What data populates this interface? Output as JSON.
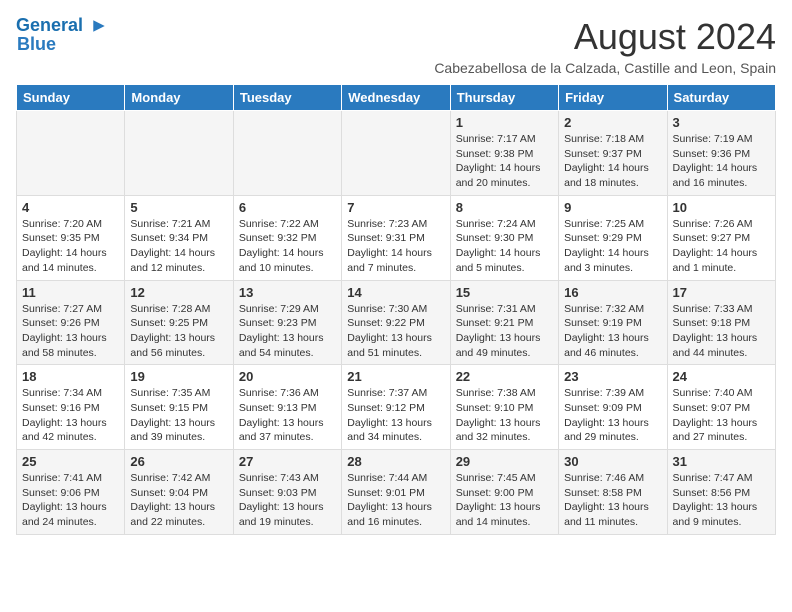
{
  "header": {
    "logo_line1": "General",
    "logo_line2": "Blue",
    "month_title": "August 2024",
    "subtitle": "Cabezabellosa de la Calzada, Castille and Leon, Spain"
  },
  "days_of_week": [
    "Sunday",
    "Monday",
    "Tuesday",
    "Wednesday",
    "Thursday",
    "Friday",
    "Saturday"
  ],
  "weeks": [
    [
      {
        "day": "",
        "info": ""
      },
      {
        "day": "",
        "info": ""
      },
      {
        "day": "",
        "info": ""
      },
      {
        "day": "",
        "info": ""
      },
      {
        "day": "1",
        "info": "Sunrise: 7:17 AM\nSunset: 9:38 PM\nDaylight: 14 hours and 20 minutes."
      },
      {
        "day": "2",
        "info": "Sunrise: 7:18 AM\nSunset: 9:37 PM\nDaylight: 14 hours and 18 minutes."
      },
      {
        "day": "3",
        "info": "Sunrise: 7:19 AM\nSunset: 9:36 PM\nDaylight: 14 hours and 16 minutes."
      }
    ],
    [
      {
        "day": "4",
        "info": "Sunrise: 7:20 AM\nSunset: 9:35 PM\nDaylight: 14 hours and 14 minutes."
      },
      {
        "day": "5",
        "info": "Sunrise: 7:21 AM\nSunset: 9:34 PM\nDaylight: 14 hours and 12 minutes."
      },
      {
        "day": "6",
        "info": "Sunrise: 7:22 AM\nSunset: 9:32 PM\nDaylight: 14 hours and 10 minutes."
      },
      {
        "day": "7",
        "info": "Sunrise: 7:23 AM\nSunset: 9:31 PM\nDaylight: 14 hours and 7 minutes."
      },
      {
        "day": "8",
        "info": "Sunrise: 7:24 AM\nSunset: 9:30 PM\nDaylight: 14 hours and 5 minutes."
      },
      {
        "day": "9",
        "info": "Sunrise: 7:25 AM\nSunset: 9:29 PM\nDaylight: 14 hours and 3 minutes."
      },
      {
        "day": "10",
        "info": "Sunrise: 7:26 AM\nSunset: 9:27 PM\nDaylight: 14 hours and 1 minute."
      }
    ],
    [
      {
        "day": "11",
        "info": "Sunrise: 7:27 AM\nSunset: 9:26 PM\nDaylight: 13 hours and 58 minutes."
      },
      {
        "day": "12",
        "info": "Sunrise: 7:28 AM\nSunset: 9:25 PM\nDaylight: 13 hours and 56 minutes."
      },
      {
        "day": "13",
        "info": "Sunrise: 7:29 AM\nSunset: 9:23 PM\nDaylight: 13 hours and 54 minutes."
      },
      {
        "day": "14",
        "info": "Sunrise: 7:30 AM\nSunset: 9:22 PM\nDaylight: 13 hours and 51 minutes."
      },
      {
        "day": "15",
        "info": "Sunrise: 7:31 AM\nSunset: 9:21 PM\nDaylight: 13 hours and 49 minutes."
      },
      {
        "day": "16",
        "info": "Sunrise: 7:32 AM\nSunset: 9:19 PM\nDaylight: 13 hours and 46 minutes."
      },
      {
        "day": "17",
        "info": "Sunrise: 7:33 AM\nSunset: 9:18 PM\nDaylight: 13 hours and 44 minutes."
      }
    ],
    [
      {
        "day": "18",
        "info": "Sunrise: 7:34 AM\nSunset: 9:16 PM\nDaylight: 13 hours and 42 minutes."
      },
      {
        "day": "19",
        "info": "Sunrise: 7:35 AM\nSunset: 9:15 PM\nDaylight: 13 hours and 39 minutes."
      },
      {
        "day": "20",
        "info": "Sunrise: 7:36 AM\nSunset: 9:13 PM\nDaylight: 13 hours and 37 minutes."
      },
      {
        "day": "21",
        "info": "Sunrise: 7:37 AM\nSunset: 9:12 PM\nDaylight: 13 hours and 34 minutes."
      },
      {
        "day": "22",
        "info": "Sunrise: 7:38 AM\nSunset: 9:10 PM\nDaylight: 13 hours and 32 minutes."
      },
      {
        "day": "23",
        "info": "Sunrise: 7:39 AM\nSunset: 9:09 PM\nDaylight: 13 hours and 29 minutes."
      },
      {
        "day": "24",
        "info": "Sunrise: 7:40 AM\nSunset: 9:07 PM\nDaylight: 13 hours and 27 minutes."
      }
    ],
    [
      {
        "day": "25",
        "info": "Sunrise: 7:41 AM\nSunset: 9:06 PM\nDaylight: 13 hours and 24 minutes."
      },
      {
        "day": "26",
        "info": "Sunrise: 7:42 AM\nSunset: 9:04 PM\nDaylight: 13 hours and 22 minutes."
      },
      {
        "day": "27",
        "info": "Sunrise: 7:43 AM\nSunset: 9:03 PM\nDaylight: 13 hours and 19 minutes."
      },
      {
        "day": "28",
        "info": "Sunrise: 7:44 AM\nSunset: 9:01 PM\nDaylight: 13 hours and 16 minutes."
      },
      {
        "day": "29",
        "info": "Sunrise: 7:45 AM\nSunset: 9:00 PM\nDaylight: 13 hours and 14 minutes."
      },
      {
        "day": "30",
        "info": "Sunrise: 7:46 AM\nSunset: 8:58 PM\nDaylight: 13 hours and 11 minutes."
      },
      {
        "day": "31",
        "info": "Sunrise: 7:47 AM\nSunset: 8:56 PM\nDaylight: 13 hours and 9 minutes."
      }
    ]
  ]
}
